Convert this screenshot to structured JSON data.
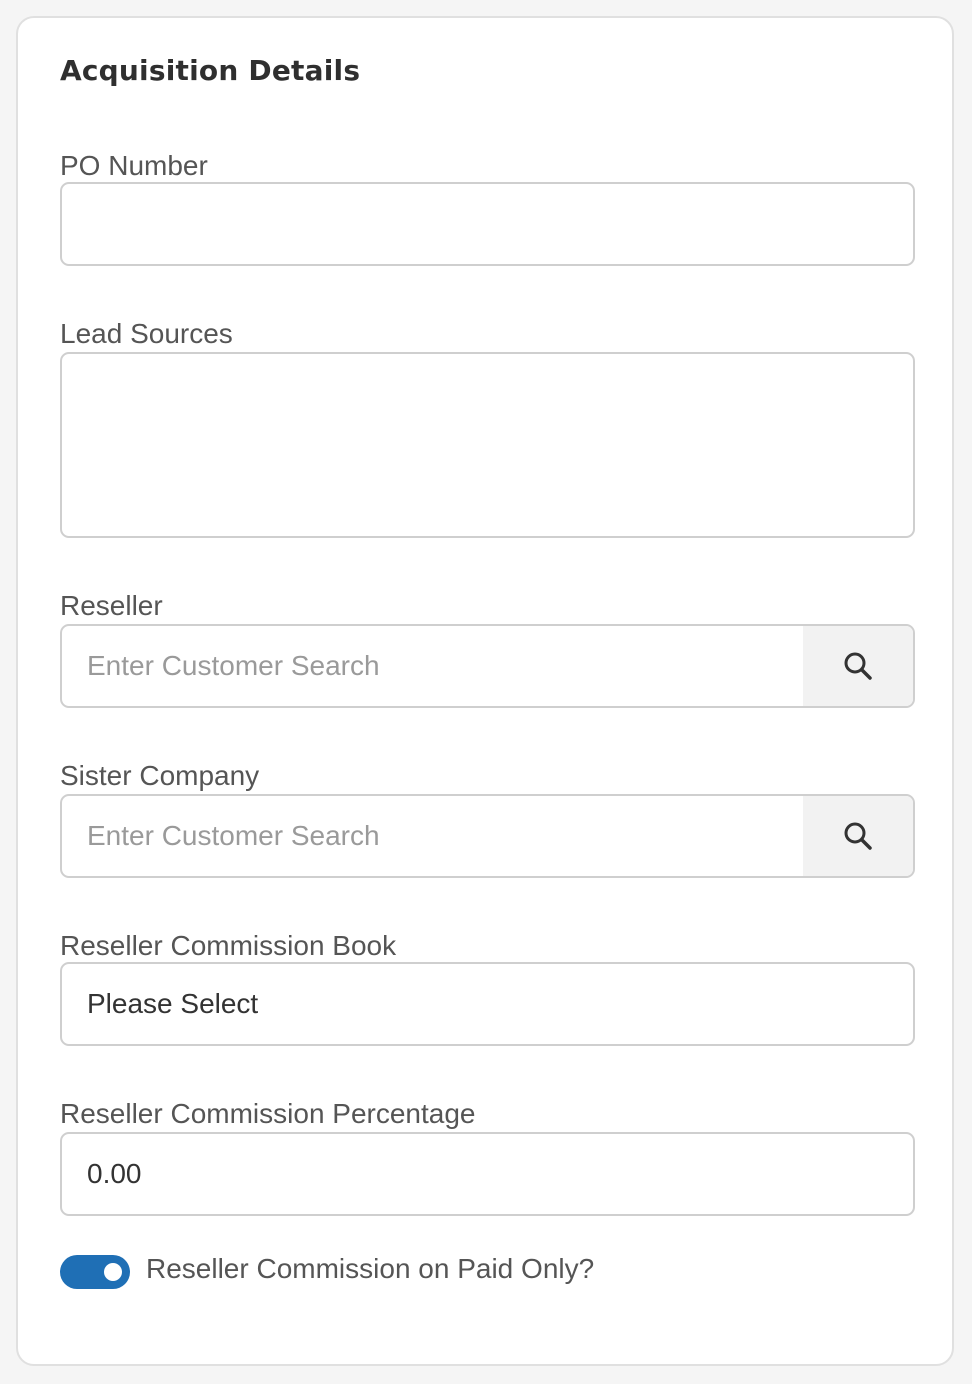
{
  "section": {
    "title": "Acquisition Details"
  },
  "po_number": {
    "label": "PO Number",
    "value": ""
  },
  "lead_sources": {
    "label": "Lead Sources",
    "value": ""
  },
  "reseller": {
    "label": "Reseller",
    "placeholder": "Enter Customer Search",
    "button_icon": "search-icon"
  },
  "sister_company": {
    "label": "Sister Company",
    "placeholder": "Enter Customer Search",
    "button_icon": "search-icon"
  },
  "reseller_commission_book": {
    "label": "Reseller Commission Book",
    "selected": "Please Select"
  },
  "reseller_commission_percentage": {
    "label": "Reseller Commission Percentage",
    "value": "0.00"
  },
  "paid_only_toggle": {
    "label": "Reseller Commission on Paid Only?",
    "checked": true,
    "color": "#1f6fb5"
  }
}
